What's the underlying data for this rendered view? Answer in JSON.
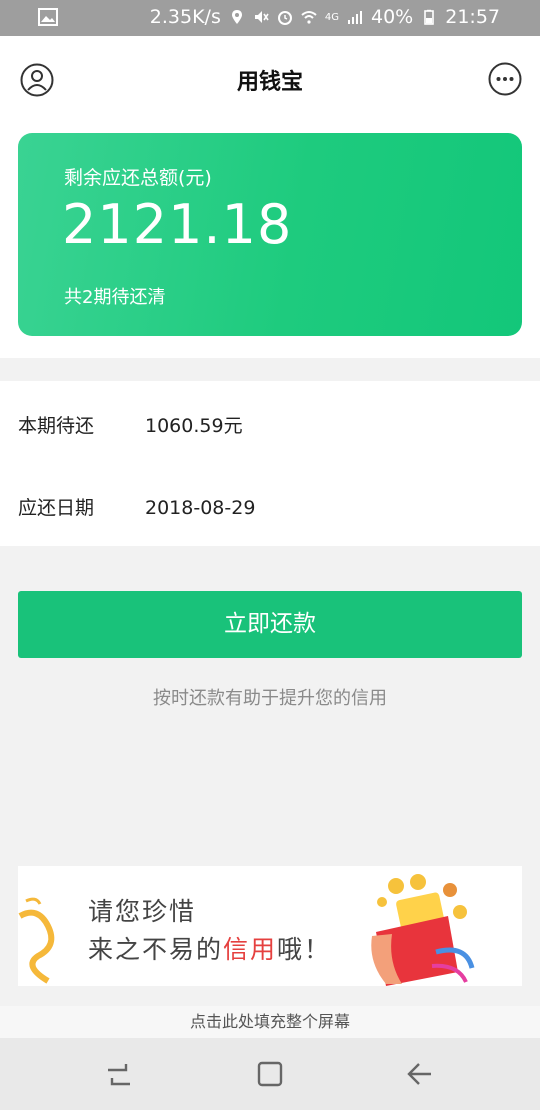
{
  "status_bar": {
    "speed": "2.35K/s",
    "network": "4G",
    "battery": "40%",
    "time": "21:57",
    "icons": [
      "image-icon",
      "location-icon",
      "mute-icon",
      "alarm-icon",
      "wifi-icon",
      "signal-icon",
      "battery-icon"
    ]
  },
  "header": {
    "title": "用钱宝"
  },
  "summary": {
    "label": "剩余应还总额(元)",
    "amount": "2121.18",
    "periods": "共2期待还清"
  },
  "info": [
    {
      "key": "本期待还",
      "value": "1060.59元"
    },
    {
      "key": "应还日期",
      "value": "2018-08-29"
    }
  ],
  "pay_button": "立即还款",
  "hint": "按时还款有助于提升您的信用",
  "banner": {
    "line1": "请您珍惜",
    "line2_a": "来之不易的",
    "line2_b": "信用",
    "line2_c": "哦！"
  },
  "fill_screen": "点击此处填充整个屏幕",
  "colors": {
    "accent": "#19c27a",
    "highlight": "#e5403f"
  }
}
